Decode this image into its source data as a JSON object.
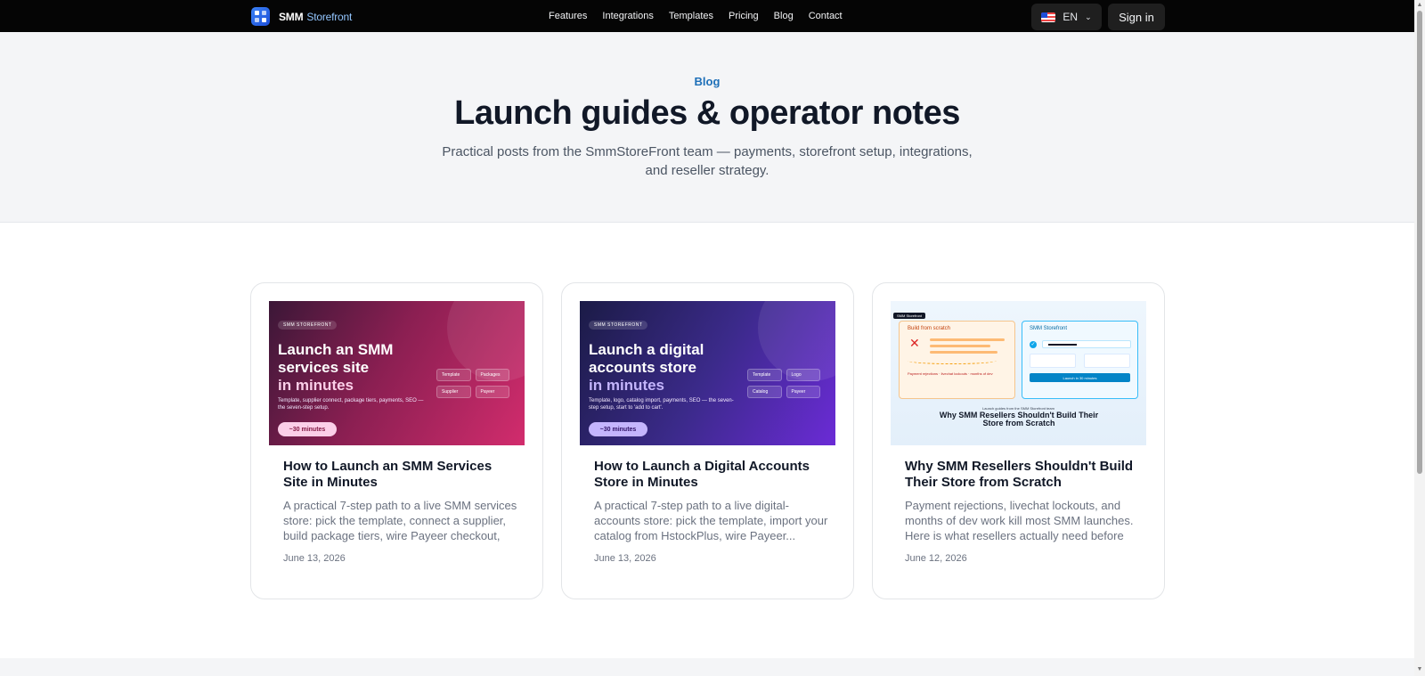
{
  "header": {
    "brand": {
      "name": "SMM",
      "sub": "Storefront"
    },
    "nav": [
      "Features",
      "Integrations",
      "Templates",
      "Pricing",
      "Blog",
      "Contact"
    ],
    "language": "EN",
    "signin": "Sign in"
  },
  "hero": {
    "eyebrow": "Blog",
    "title": "Launch guides & operator notes",
    "subtitle": "Practical posts from the SmmStoreFront team — payments, storefront setup, integrations, and reseller strategy."
  },
  "posts": [
    {
      "title": "How to Launch an SMM Services Site in Minutes",
      "excerpt": "A practical 7-step path to a live SMM services store: pick the template, connect a supplier, build package tiers, wire Payeer checkout, an...",
      "date": "June 13, 2026",
      "thumb": {
        "pill": "SMM STOREFRONT",
        "line1": "Launch an SMM",
        "line2": "services site",
        "line3": "in minutes",
        "body": "Template, supplier connect, package tiers, payments, SEO — the seven-step setup.",
        "chip": "~30 minutes",
        "tiles": [
          "Template",
          "Packages",
          "Supplier",
          "Payeer"
        ]
      }
    },
    {
      "title": "How to Launch a Digital Accounts Store in Minutes",
      "excerpt": "A practical 7-step path to a live digital-accounts store: pick the template, import your catalog from HstockPlus, wire Payeer...",
      "date": "June 13, 2026",
      "thumb": {
        "pill": "SMM STOREFRONT",
        "line1": "Launch a digital",
        "line2": "accounts store",
        "line3": "in minutes",
        "body": "Template, logo, catalog import, payments, SEO — the seven-step setup, start to 'add to cart'.",
        "chip": "~30 minutes",
        "tiles": [
          "Template",
          "Logo",
          "Catalog",
          "Payeer"
        ]
      }
    },
    {
      "title": "Why SMM Resellers Shouldn't Build Their Store from Scratch",
      "excerpt": "Payment rejections, livechat lockouts, and months of dev work kill most SMM launches. Here is what resellers actually need before d...",
      "date": "June 12, 2026",
      "thumb": {
        "badge": "SMM Storefront",
        "left_title": "Build from scratch",
        "left_foot": "Payment rejections · livechat lockouts · months of dev",
        "right_title": "SMM Storefront",
        "button": "Launch in 30 minutes",
        "caption_small": "Launch guides from the SMM Storefront team",
        "caption": "Why SMM Resellers Shouldn't Build Their Store from Scratch"
      }
    }
  ],
  "colors": {
    "accent": "#1d6fb8",
    "header_bg": "#050505",
    "hero_bg": "#f4f5f7"
  }
}
